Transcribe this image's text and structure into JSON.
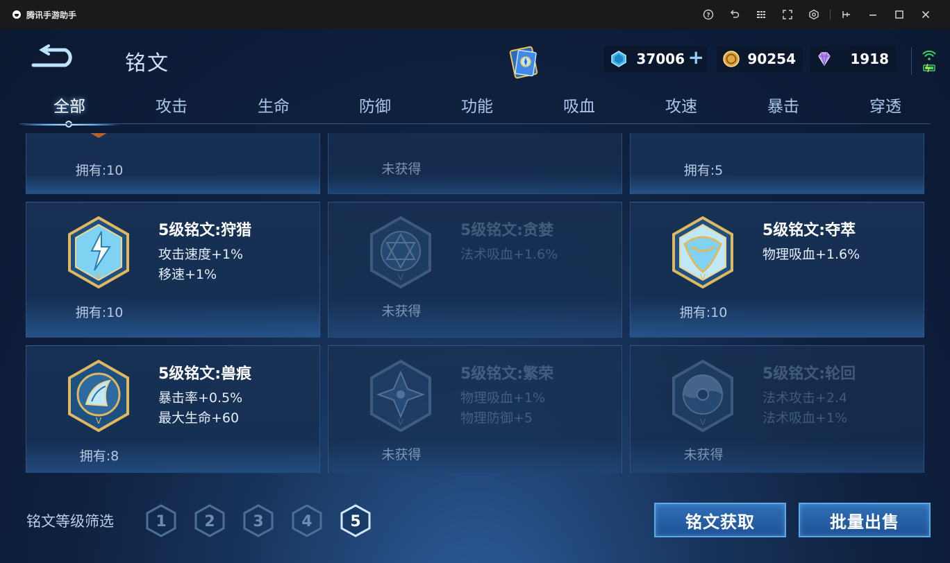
{
  "window": {
    "app_title": "腾讯手游助手",
    "controls": [
      "help-icon",
      "undo-icon",
      "menu-icon",
      "fullscreen-icon",
      "settings-icon",
      "pin-icon",
      "minimize-icon",
      "maximize-icon",
      "close-icon"
    ]
  },
  "header": {
    "title": "铭文",
    "currencies": [
      {
        "name": "diamond",
        "value": "37006",
        "has_plus": true
      },
      {
        "name": "gold",
        "value": "90254",
        "has_plus": false
      },
      {
        "name": "crystal",
        "value": "1918",
        "has_plus": false
      }
    ]
  },
  "tabs": [
    {
      "label": "全部",
      "active": true
    },
    {
      "label": "攻击",
      "active": false
    },
    {
      "label": "生命",
      "active": false
    },
    {
      "label": "防御",
      "active": false
    },
    {
      "label": "功能",
      "active": false
    },
    {
      "label": "吸血",
      "active": false
    },
    {
      "label": "攻速",
      "active": false
    },
    {
      "label": "暴击",
      "active": false
    },
    {
      "label": "穿透",
      "active": false
    }
  ],
  "top_row": [
    {
      "owned": "拥有:10",
      "locked": false
    },
    {
      "owned": "未获得",
      "locked": true
    },
    {
      "owned": "拥有:5",
      "locked": false
    }
  ],
  "cards": [
    {
      "name": "5级铭文:狩猎",
      "attrs": [
        "攻击速度+1%",
        "移速+1%"
      ],
      "owned": "拥有:10",
      "locked": false,
      "icon": "hunt-rune-icon"
    },
    {
      "name": "5级铭文:贪婪",
      "attrs": [
        "法术吸血+1.6%"
      ],
      "owned": "未获得",
      "locked": true,
      "icon": "greed-rune-icon"
    },
    {
      "name": "5级铭文:夺萃",
      "attrs": [
        "物理吸血+1.6%"
      ],
      "owned": "拥有:10",
      "locked": false,
      "icon": "extract-rune-icon"
    },
    {
      "name": "5级铭文:兽痕",
      "attrs": [
        "暴击率+0.5%",
        "最大生命+60"
      ],
      "owned": "拥有:8",
      "locked": false,
      "icon": "beast-mark-rune-icon"
    },
    {
      "name": "5级铭文:繁荣",
      "attrs": [
        "物理吸血+1%",
        "物理防御+5"
      ],
      "owned": "未获得",
      "locked": true,
      "icon": "prosperity-rune-icon"
    },
    {
      "name": "5级铭文:轮回",
      "attrs": [
        "法术攻击+2.4",
        "法术吸血+1%"
      ],
      "owned": "未获得",
      "locked": true,
      "icon": "reincarnation-rune-icon"
    }
  ],
  "footer": {
    "filter_label": "铭文等级筛选",
    "levels": [
      "1",
      "2",
      "3",
      "4",
      "5"
    ],
    "selected_level": "5",
    "obtain_button": "铭文获取",
    "sell_button": "批量出售"
  },
  "colors": {
    "accent": "#5db7ff",
    "button_bg": "#2e6fb7",
    "gold_frame": "#d9b25a"
  }
}
